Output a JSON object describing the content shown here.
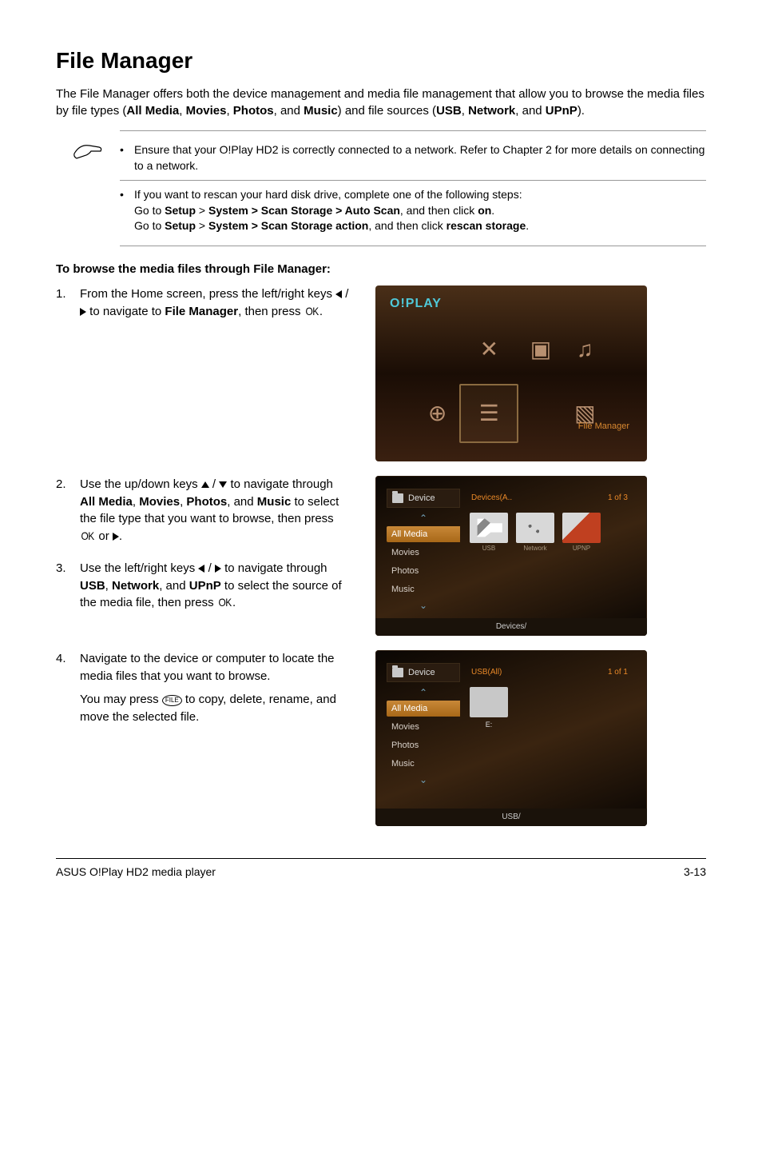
{
  "title": "File Manager",
  "intro_parts": {
    "p1": "The File Manager offers both the device management and media file management that allow you to browse the media files by file types (",
    "b1": "All Media",
    "s1": ", ",
    "b2": "Movies",
    "s2": ", ",
    "b3": "Photos",
    "s3": ", and ",
    "b4": "Music",
    "s4": ") and file sources (",
    "b5": "USB",
    "s5": ", ",
    "b6": "Network",
    "s6": ", and ",
    "b7": "UPnP",
    "s7": ")."
  },
  "notes": {
    "n1": "Ensure that your O!Play HD2 is correctly connected to a network. Refer to Chapter 2 for more details on connecting to a network.",
    "n2": "If you want to rescan your hard disk drive, complete one of the following steps:",
    "n2a_pre": "Go to ",
    "n2a_b": "Setup",
    "n2a_gt": " > ",
    "n2a_b2": "System > Scan Storage > Auto Scan",
    "n2a_mid": ", and then click ",
    "n2a_b3": "on",
    "n2a_end": ".",
    "n2b_pre": "Go to ",
    "n2b_b": "Setup",
    "n2b_gt": " > ",
    "n2b_b2": "System > Scan Storage action",
    "n2b_mid": ", and then click ",
    "n2b_b3": "rescan storage",
    "n2b_end": "."
  },
  "section_heading": "To browse the media files through File Manager:",
  "steps": {
    "s1_num": "1.",
    "s1_a": "From the Home screen, press the left/right keys ",
    "s1_b": " / ",
    "s1_c": " to navigate to ",
    "s1_bold": "File Manager",
    "s1_d": ", then press ",
    "s1_e": ".",
    "s2_num": "2.",
    "s2_a": "Use the up/down keys ",
    "s2_b": " / ",
    "s2_c": " to navigate through ",
    "s2_b1": "All Media",
    "s2_s1": ", ",
    "s2_b2": "Movies",
    "s2_s2": ", ",
    "s2_b3": "Photos",
    "s2_s3": ", and ",
    "s2_b4": "Music",
    "s2_d": " to select the file type that you want to browse, then press ",
    "s2_e": " or ",
    "s2_f": ".",
    "s3_num": "3.",
    "s3_a": "Use the left/right keys ",
    "s3_b": " / ",
    "s3_c": " to navigate through ",
    "s3_b1": "USB",
    "s3_s1": ", ",
    "s3_b2": "Network",
    "s3_s2": ", and ",
    "s3_b3": "UPnP",
    "s3_d": " to select the source of the media file, then press ",
    "s3_e": ".",
    "s4_num": "4.",
    "s4_a": "Navigate to the device or computer to locate the media files that you want to browse.",
    "s4_b": "You may press ",
    "s4_c": " to copy, delete, rename, and move the selected file."
  },
  "thumb": {
    "oplay": "O!PLAY",
    "fm_label": "File Manager",
    "device": "Device",
    "all_media": "All Media",
    "movies": "Movies",
    "photos": "Photos",
    "music": "Music",
    "t2_crumb": "Devices(A..",
    "t2_count": "1 of 3",
    "t2_usb": "USB",
    "t2_net": "Network",
    "t2_upnp": "UPNP",
    "t2_bottom": "Devices/",
    "t3_crumb": "USB(All)",
    "t3_count": "1 of 1",
    "t3_item": "E:",
    "t3_bottom": "USB/"
  },
  "key_labels": {
    "ok": "OK",
    "file": "FILE"
  },
  "footer": {
    "left": "ASUS O!Play HD2 media player",
    "right": "3-13"
  }
}
